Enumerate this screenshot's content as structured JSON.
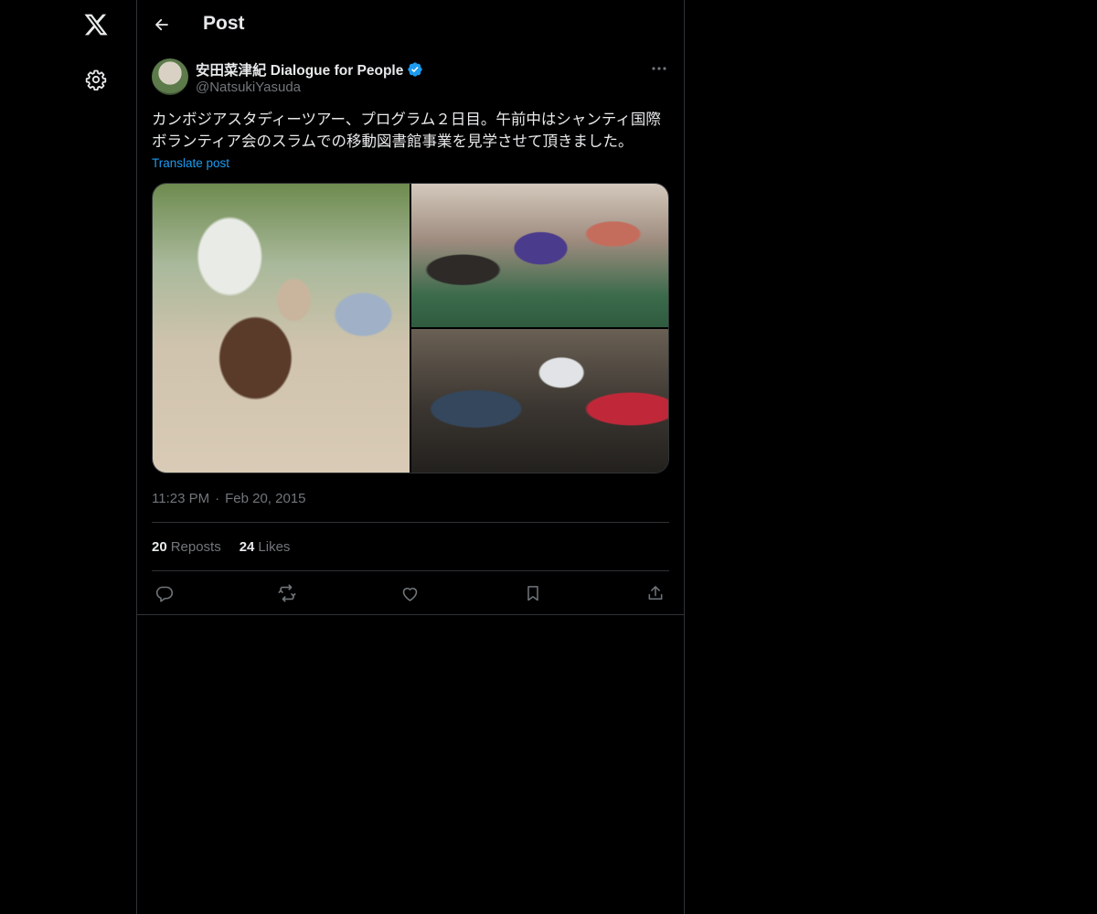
{
  "header": {
    "title": "Post"
  },
  "post": {
    "author": {
      "display_name": "安田菜津紀 Dialogue for People",
      "handle": "@NatsukiYasuda"
    },
    "text": "カンボジアスタディーツアー、プログラム２日目。午前中はシャンティ国際ボランティア会のスラムでの移動図書館事業を見学させて頂きました。",
    "translate_label": "Translate post",
    "time": "11:23 PM",
    "date": "Feb 20, 2015",
    "stats": {
      "reposts_count": "20",
      "reposts_label": "Reposts",
      "likes_count": "24",
      "likes_label": "Likes"
    }
  },
  "icons": {
    "logo": "x-logo-icon",
    "settings": "gear-icon",
    "back": "back-arrow-icon",
    "more": "more-horizontal-icon",
    "verified": "verified-badge-icon",
    "reply": "reply-icon",
    "repost": "repost-icon",
    "like": "heart-icon",
    "bookmark": "bookmark-icon",
    "share": "share-icon"
  },
  "colors": {
    "background": "#000000",
    "text_primary": "#e7e9ea",
    "text_secondary": "#71767b",
    "accent": "#1d9bf0",
    "border": "#2f3336"
  }
}
